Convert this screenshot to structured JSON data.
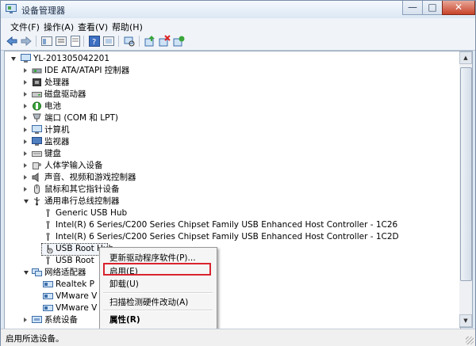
{
  "window": {
    "title": "设备管理器",
    "minimize": "—",
    "maximize": "□",
    "close": "✕"
  },
  "menu": [
    "文件(F)",
    "操作(A)",
    "查看(V)",
    "帮助(H)"
  ],
  "tree": {
    "root": "YL-201305042201",
    "categories": [
      "IDE ATA/ATAPI 控制器",
      "处理器",
      "磁盘驱动器",
      "电池",
      "端口 (COM 和 LPT)",
      "计算机",
      "监视器",
      "键盘",
      "人体学输入设备",
      "声音、视频和游戏控制器",
      "鼠标和其它指针设备",
      "通用串行总线控制器"
    ],
    "usb_children": [
      "Generic USB Hub",
      "Intel(R) 6 Series/C200 Series Chipset Family USB Enhanced Host Controller - 1C26",
      "Intel(R) 6 Series/C200 Series Chipset Family USB Enhanced Host Controller - 1C2D",
      "USB Root Hub",
      "USB Root Hub"
    ],
    "usb_children_visible": [
      "Generic USB Hub",
      "Intel(R) 6 Series/C200 Series Chipset Family USB Enhanced Host Controller - 1C26",
      "Intel(R) 6 Series/C200 Series Chipset Family USB Enhanced Host Controller - 1C2D",
      "USB Root Hub",
      "USB Root"
    ],
    "network_label": "网络适配器",
    "network_children": [
      "Realtek P",
      "VMware V",
      "VMware V"
    ],
    "system_devices": "系统设备"
  },
  "context_menu": {
    "update_driver": "更新驱动程序软件(P)...",
    "enable": "启用(E)",
    "uninstall": "卸载(U)",
    "scan": "扫描检测硬件改动(A)",
    "properties": "属性(R)"
  },
  "status": "启用所选设备。"
}
